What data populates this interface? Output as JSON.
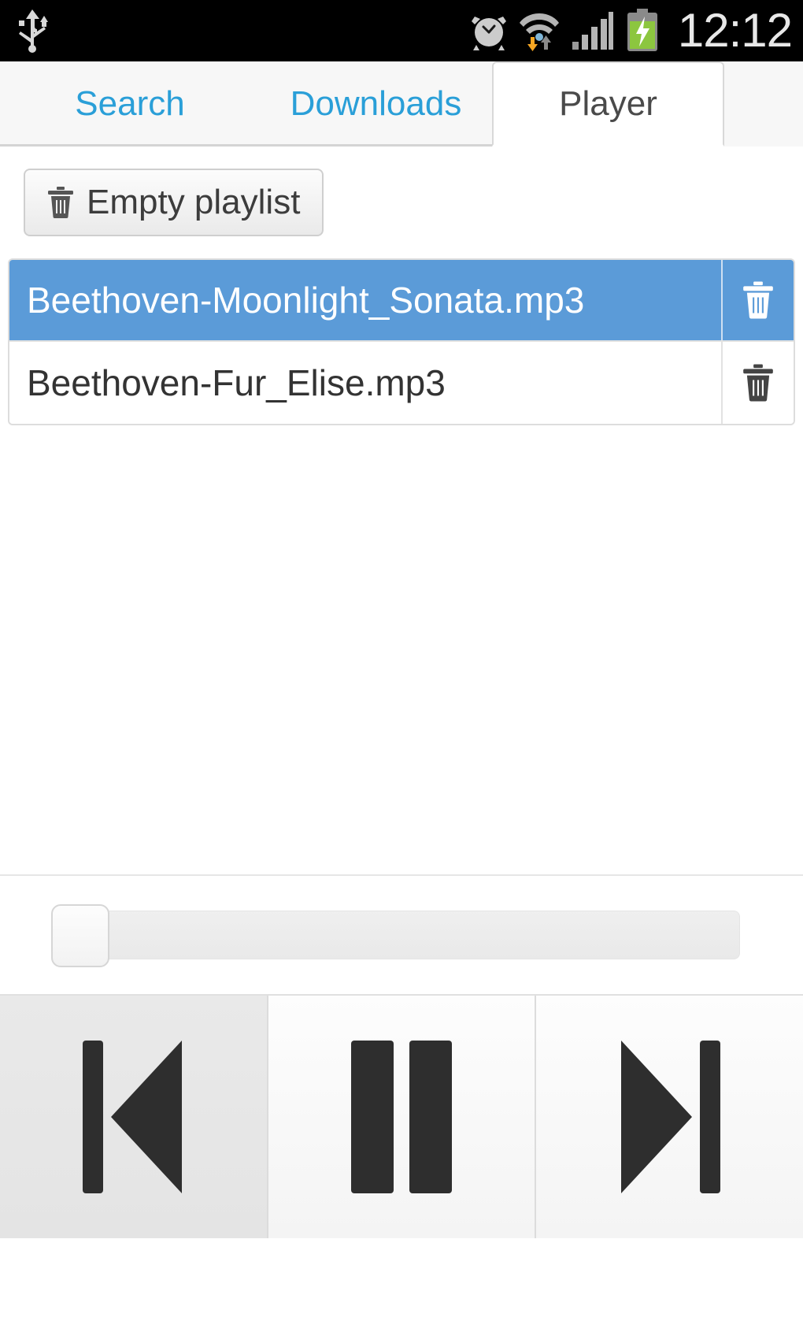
{
  "status_bar": {
    "usb_icon": "usb-icon",
    "alarm_icon": "alarm-clock-icon",
    "wifi_icon": "wifi-download-icon",
    "signal_icon": "cell-signal-icon",
    "battery_icon": "battery-charging-icon",
    "time": "12:12",
    "background_color": "#000000",
    "text_color": "#e8e8e8",
    "battery_color": "#8cc63f"
  },
  "tabs": {
    "items": [
      {
        "label": "Search",
        "active": false
      },
      {
        "label": "Downloads",
        "active": false
      },
      {
        "label": "Player",
        "active": true
      }
    ],
    "inactive_color": "#2a9fd8",
    "active_color": "#4a4a4a"
  },
  "toolbar": {
    "empty_playlist_label": "Empty playlist",
    "trash_icon": "trash-icon"
  },
  "playlist": {
    "tracks": [
      {
        "name": "Beethoven-Moonlight_Sonata.mp3",
        "selected": true,
        "delete_icon": "trash-icon"
      },
      {
        "name": "Beethoven-Fur_Elise.mp3",
        "selected": false,
        "delete_icon": "trash-icon"
      }
    ],
    "selected_color": "#5b9bd8",
    "selected_text_color": "#ffffff"
  },
  "seek": {
    "value": 0,
    "min": 0,
    "max": 100,
    "handle_position_percent": 0
  },
  "controls": {
    "buttons": [
      {
        "name": "previous",
        "icon": "skip-previous-icon",
        "pressed": true
      },
      {
        "name": "pause",
        "icon": "pause-icon",
        "pressed": false
      },
      {
        "name": "next",
        "icon": "skip-next-icon",
        "pressed": false
      }
    ]
  }
}
